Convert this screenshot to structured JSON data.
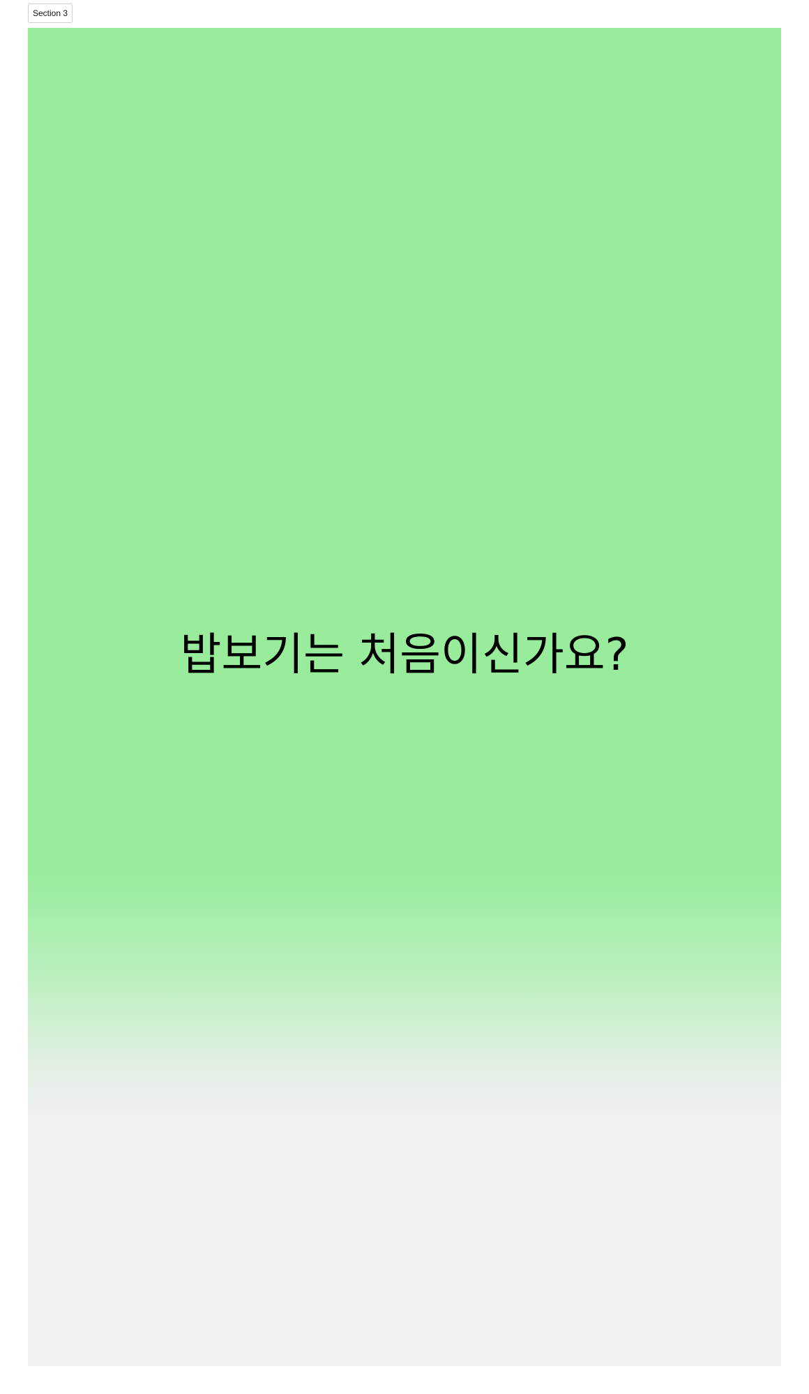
{
  "section_tab": {
    "label": "Section 3"
  },
  "panel": {
    "headline": "밥보기는 처음이신가요?",
    "colors": {
      "top": "#98ec9c",
      "bottom": "#f1f1f1"
    }
  }
}
